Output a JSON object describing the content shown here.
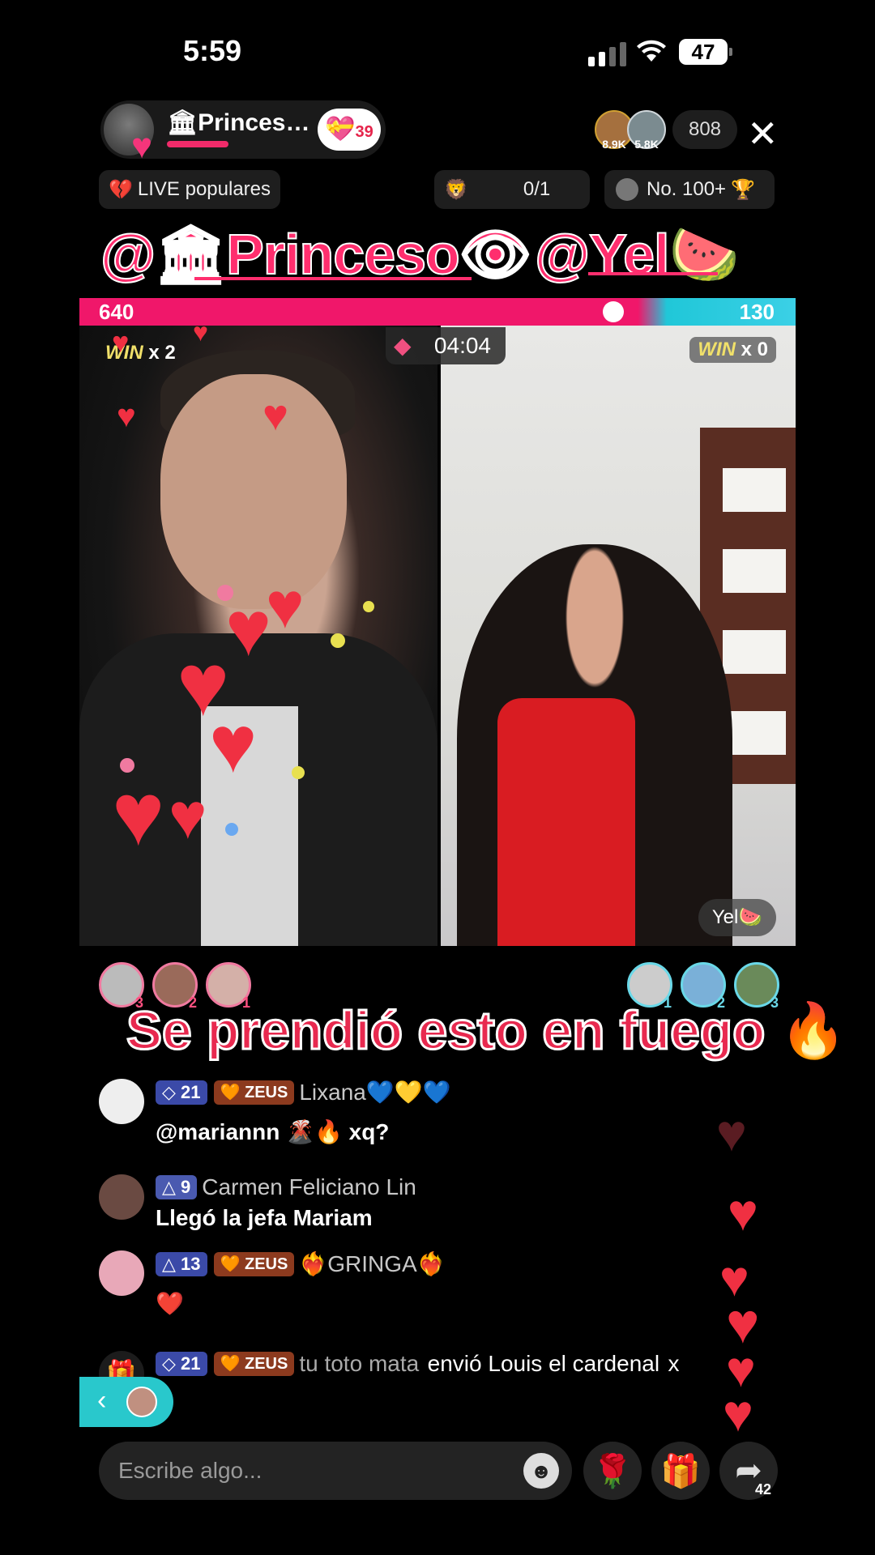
{
  "status_bar": {
    "time": "5:59",
    "battery": "47"
  },
  "host": {
    "name": "🏛Princes…",
    "follow_count": "39"
  },
  "viewers": {
    "avatars": [
      {
        "count": "8.9K"
      },
      {
        "count": "5.8K"
      }
    ],
    "total": "808"
  },
  "chips": {
    "popular": "LIVE populares",
    "goal": "0/1",
    "rank": "No. 100+"
  },
  "mentions": {
    "left": "@🏛Princeso👁",
    "right": "@Yel🍉"
  },
  "battle": {
    "score_left": "640",
    "score_right": "130",
    "timer": "04:04",
    "win_left": "x 2",
    "win_right": "x 0",
    "win_word": "WIN",
    "right_label": "Yel🍉"
  },
  "supporters": {
    "left_ranks": [
      "3",
      "2",
      "1"
    ],
    "right_ranks": [
      "1",
      "2",
      "3"
    ]
  },
  "caption": "Se prendió esto en fuego 🔥",
  "chat": [
    {
      "level": "21",
      "badge": "ZEUS",
      "user": "Lixana💙💛💙",
      "text": "@mariannn 🌋🔥 xq?"
    },
    {
      "level": "9",
      "badge": "",
      "user": "Carmen Feliciano Lin",
      "text": "Llegó la jefa Mariam"
    },
    {
      "level": "13",
      "badge": "ZEUS",
      "user": "❤️‍🔥GRINGA❤️‍🔥",
      "text": "❤️"
    },
    {
      "level": "21",
      "badge": "ZEUS",
      "user": "tu toto mata",
      "text": "envió Louis el cardenal",
      "suffix": "x"
    }
  ],
  "bottom": {
    "placeholder": "Escribe algo...",
    "share_count": "42"
  },
  "colors": {
    "accent_pink": "#f0176a",
    "accent_teal": "#20c7d8",
    "heart": "#f03042"
  }
}
